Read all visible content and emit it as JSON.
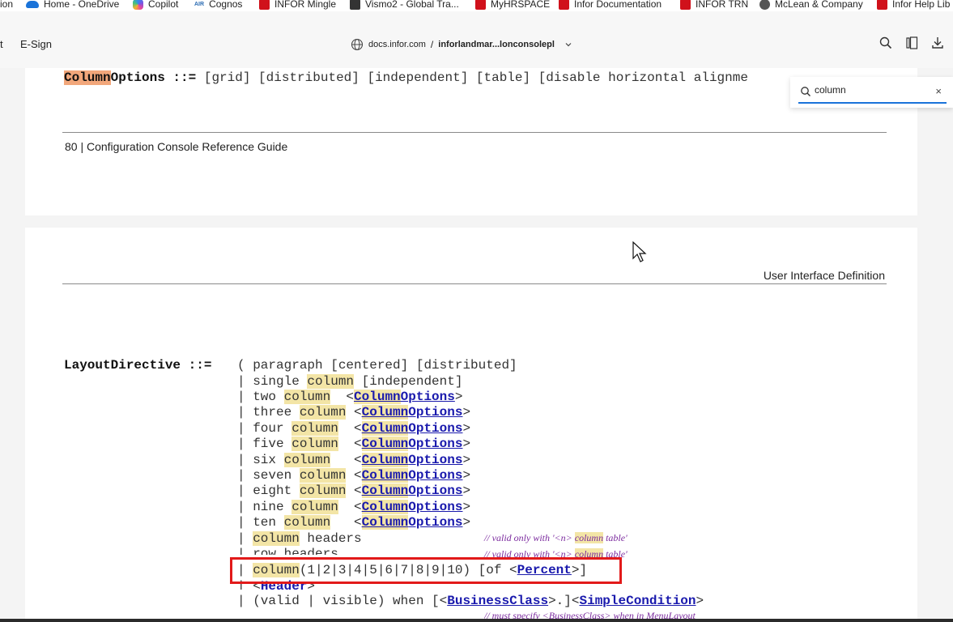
{
  "bookmarks": [
    {
      "label": "ion",
      "icon": "blank"
    },
    {
      "label": "Home - OneDrive",
      "icon": "onedrive-icon"
    },
    {
      "label": "Copilot",
      "icon": "copilot-icon"
    },
    {
      "label": "Cognos",
      "icon": "air-icon",
      "prefix": "AIR"
    },
    {
      "label": "INFOR Mingle",
      "icon": "infor-icon"
    },
    {
      "label": "Vismo2 - Global Tra...",
      "icon": "vismo-icon"
    },
    {
      "label": "MyHRSPACE",
      "icon": "infor-icon"
    },
    {
      "label": "Infor Documentation",
      "icon": "infor-icon"
    },
    {
      "label": "INFOR TRN",
      "icon": "infor-icon"
    },
    {
      "label": "McLean & Company",
      "icon": "globe-icon"
    },
    {
      "label": "Infor Help Lib",
      "icon": "infor-icon"
    }
  ],
  "toolbar": {
    "left_partial": "t",
    "esign": "E-Sign",
    "domain": "docs.infor.com",
    "separator": "/",
    "filename": "inforlandmar...lonconsolepl"
  },
  "find": {
    "query": "column",
    "close": "×"
  },
  "page1": {
    "col_hl": "Column",
    "col_rest": "Options ::=",
    "col_def": " [grid] [distributed] [independent] [table] [disable horizontal alignme",
    "footer": "80 | Configuration Console Reference Guide"
  },
  "page2": {
    "header": "User Interface Definition",
    "directive": "LayoutDirective ::=",
    "first_line": "( paragraph [centered] [distributed]",
    "single": {
      "pre": "| single ",
      "hl": "column",
      "post": " [independent]"
    },
    "numbered": [
      {
        "pre": "| two ",
        "hl": "column",
        "gap": "  <"
      },
      {
        "pre": "| three ",
        "hl": "column",
        "gap": " <"
      },
      {
        "pre": "| four ",
        "hl": "column",
        "gap": "  <"
      },
      {
        "pre": "| five ",
        "hl": "column",
        "gap": "  <"
      },
      {
        "pre": "| six ",
        "hl": "column",
        "gap": "   <"
      },
      {
        "pre": "| seven ",
        "hl": "column",
        "gap": " <"
      },
      {
        "pre": "| eight ",
        "hl": "column",
        "gap": " <"
      },
      {
        "pre": "| nine ",
        "hl": "column",
        "gap": "  <"
      },
      {
        "pre": "| ten ",
        "hl": "column",
        "gap": "   <"
      }
    ],
    "link_hl": "Column",
    "link_rest": "Options",
    "close_angle": ">",
    "col_headers": {
      "pre": "| ",
      "hl": "column",
      "post": " headers"
    },
    "row_headers": "| row headers",
    "comment_pre": "// valid only with '<n> ",
    "comment_hl": "column",
    "comment_post": " table'",
    "col_numbers": {
      "pre": "| ",
      "hl": "column",
      "post": "(1|2|3|4|5|6|7|8|9|10) [of <",
      "link": "Percent",
      "end": ">]"
    },
    "header_line": {
      "pre": "| <",
      "link": "Header",
      "end": ">"
    },
    "valid_line": {
      "pre": "| (valid | visible) when [<",
      "link1": "BusinessClass",
      "mid": ">.]<",
      "link2": "SimpleCondition",
      "end": ">"
    },
    "must_comment": "// must specify <BusinessClass> when in MenuLayout"
  }
}
